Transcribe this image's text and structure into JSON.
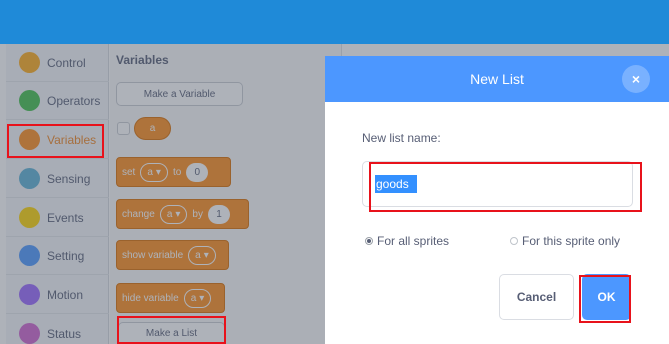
{
  "categories": [
    {
      "label": "Control",
      "color": "#ffab19"
    },
    {
      "label": "Operators",
      "color": "#40bf4a"
    },
    {
      "label": "Variables",
      "color": "#ff8c1a"
    },
    {
      "label": "Sensing",
      "color": "#5cb1d6"
    },
    {
      "label": "Events",
      "color": "#ffd500"
    },
    {
      "label": "Setting",
      "color": "#4c97ff"
    },
    {
      "label": "Motion",
      "color": "#9966ff"
    },
    {
      "label": "Status",
      "color": "#cf63cf"
    }
  ],
  "selected_category": "Variables",
  "palette": {
    "title": "Variables",
    "make_variable_label": "Make a Variable",
    "variable_reporter": "a",
    "set_block": {
      "text": "set",
      "var": "a",
      "to": "to",
      "value": "0"
    },
    "change_block": {
      "text": "change",
      "var": "a",
      "by": "by",
      "value": "1"
    },
    "show_block": {
      "text": "show variable",
      "var": "a"
    },
    "hide_block": {
      "text": "hide variable",
      "var": "a"
    },
    "make_list_label": "Make a List"
  },
  "dialog": {
    "title": "New List",
    "close_symbol": "×",
    "field_label": "New list name:",
    "input_value": "goods",
    "radio_all": "For all sprites",
    "radio_this": "For this sprite only",
    "cancel_label": "Cancel",
    "ok_label": "OK"
  },
  "colors": {
    "topbar": "#1f8ad8",
    "dialog_header": "#4c97ff",
    "variables_orange": "#ff8c1a",
    "highlight_red": "#e8121b"
  }
}
